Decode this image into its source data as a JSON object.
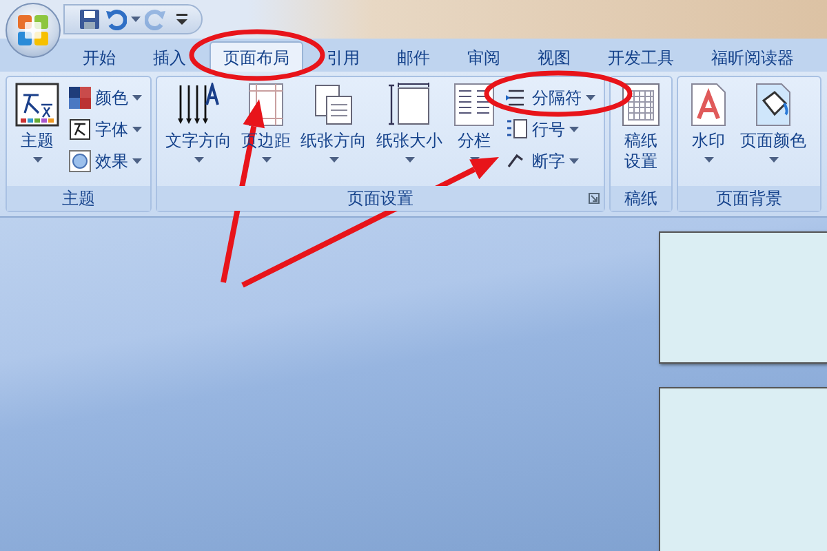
{
  "quick_access": [
    {
      "kind": "save",
      "disabled": false
    },
    {
      "kind": "undo",
      "disabled": false
    },
    {
      "kind": "redo",
      "disabled": true
    },
    {
      "kind": "customize",
      "disabled": false
    }
  ],
  "tabs": [
    {
      "label": "开始",
      "selected": false
    },
    {
      "label": "插入",
      "selected": false
    },
    {
      "label": "页面布局",
      "selected": true
    },
    {
      "label": "引用",
      "selected": false
    },
    {
      "label": "邮件",
      "selected": false
    },
    {
      "label": "审阅",
      "selected": false
    },
    {
      "label": "视图",
      "selected": false
    },
    {
      "label": "开发工具",
      "selected": false
    },
    {
      "label": "福昕阅读器",
      "selected": false
    }
  ],
  "groups": [
    {
      "label": "主题",
      "launcher": false,
      "commands": [
        {
          "kind": "large",
          "label": "主题",
          "dropdown": true
        },
        {
          "kind": "small",
          "label": "颜色",
          "dropdown": true
        },
        {
          "kind": "small",
          "label": "字体",
          "dropdown": true
        },
        {
          "kind": "small",
          "label": "效果",
          "dropdown": true
        }
      ]
    },
    {
      "label": "页面设置",
      "launcher": true,
      "commands": [
        {
          "kind": "large",
          "label": "文字方向",
          "dropdown": true
        },
        {
          "kind": "large",
          "label": "页边距",
          "dropdown": true
        },
        {
          "kind": "large",
          "label": "纸张方向",
          "dropdown": true
        },
        {
          "kind": "large",
          "label": "纸张大小",
          "dropdown": true
        },
        {
          "kind": "large",
          "label": "分栏",
          "dropdown": true
        },
        {
          "kind": "small",
          "label": "分隔符",
          "dropdown": true
        },
        {
          "kind": "small",
          "label": "行号",
          "dropdown": true
        },
        {
          "kind": "small",
          "label": "断字",
          "dropdown": true
        }
      ]
    },
    {
      "label": "稿纸",
      "launcher": false,
      "commands": [
        {
          "kind": "large",
          "label": "稿纸设置",
          "dropdown": false
        }
      ]
    },
    {
      "label": "页面背景",
      "launcher": false,
      "commands": [
        {
          "kind": "large",
          "label": "水印",
          "dropdown": true
        },
        {
          "kind": "large",
          "label": "页面颜色",
          "dropdown": true
        }
      ]
    }
  ],
  "annotations": [
    {
      "kind": "ellipse"
    },
    {
      "kind": "ellipse"
    },
    {
      "kind": "arrow"
    },
    {
      "kind": "arrow"
    }
  ]
}
